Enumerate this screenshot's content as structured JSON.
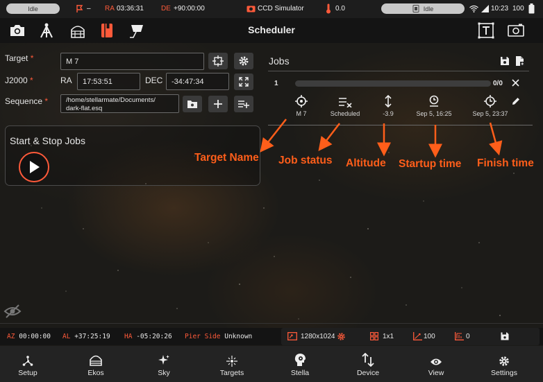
{
  "status_bar": {
    "left_pill": "Idle",
    "flag_value": "–",
    "ra_label": "RA",
    "ra_value": "03:36:31",
    "de_label": "DE",
    "de_value": "+90:00:00",
    "device": "CCD Simulator",
    "temperature": "0.0",
    "right_pill": "Idle",
    "clock": "10:23",
    "battery": "100"
  },
  "app_bar": {
    "title": "Scheduler"
  },
  "form": {
    "target_label": "Target",
    "target_value": "M 7",
    "j2000_label": "J2000",
    "ra_label": "RA",
    "ra_value": "17:53:51",
    "dec_label": "DEC",
    "dec_value": "-34:47:34",
    "sequence_label": "Sequence",
    "sequence_line1": "/home/stellarmate/Documents/",
    "sequence_line2": "dark-flat.esq",
    "required_mark": "*"
  },
  "start_stop": {
    "title": "Start & Stop Jobs"
  },
  "jobs": {
    "title": "Jobs",
    "items": [
      {
        "index": "1",
        "progress": "0/0",
        "progress_fraction": 0,
        "target": "M 7",
        "status": "Scheduled",
        "altitude": "-3.9",
        "startup": "Sep 5, 16:25",
        "finish": "Sep 5, 23:37"
      }
    ]
  },
  "annotations": {
    "target_name": "Target Name",
    "job_status": "Job status",
    "altitude": "Altitude",
    "startup_time": "Startup time",
    "finish_time": "Finish time"
  },
  "bottom_status": {
    "az_label": "AZ",
    "az_value": "00:00:00",
    "al_label": "AL",
    "al_value": "+37:25:19",
    "ha_label": "HA",
    "ha_value": "-05:20:26",
    "pier_label": "Pier Side",
    "pier_value": "Unknown",
    "resolution": "1280x1024",
    "binning": "1x1",
    "gain": "100",
    "offset": "0"
  },
  "nav": [
    {
      "label": "Setup",
      "icon": "setup-icon"
    },
    {
      "label": "Ekos",
      "icon": "ekos-icon"
    },
    {
      "label": "Sky",
      "icon": "sky-icon"
    },
    {
      "label": "Targets",
      "icon": "targets-icon"
    },
    {
      "label": "Stella",
      "icon": "stella-icon"
    },
    {
      "label": "Device",
      "icon": "device-icon"
    },
    {
      "label": "View",
      "icon": "view-icon"
    },
    {
      "label": "Settings",
      "icon": "settings-icon"
    }
  ],
  "colors": {
    "accent": "#ff5a3a",
    "annotation": "#ff5e1a",
    "nav_bg": "#232323",
    "appbar_bg": "#141414"
  }
}
